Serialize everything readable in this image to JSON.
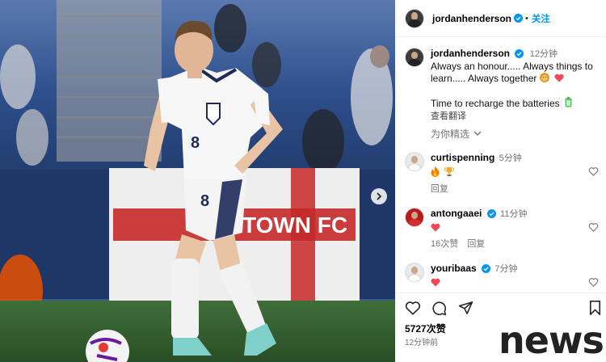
{
  "post": {
    "author": "jordanhenderson",
    "follow_label": "关注",
    "caption_time": "12分钟",
    "caption_line1": "Always an honour..... Always things to",
    "caption_line2": "learn..... Always together",
    "caption_line3": "Time to recharge the batteries",
    "translate_label": "查看翻译",
    "featured_label": "为你精选",
    "likes": "5727次赞",
    "time_ago": "12分钟前"
  },
  "photo": {
    "shirt_number": "8",
    "banner_text": "TOWN FC"
  },
  "comments": [
    {
      "user": "curtispenning",
      "time": "5分钟",
      "reply_label": "回复"
    },
    {
      "user": "antongaaei",
      "time": "11分钟",
      "likes": "16次赞",
      "reply_label": "回复"
    },
    {
      "user": "youribaas",
      "time": "7分钟"
    }
  ],
  "watermark": "news",
  "colors": {
    "link": "#0095f6",
    "verified": "#0095f6",
    "heart": "#ed4956",
    "muted": "#737373"
  },
  "icons": [
    "heart-icon",
    "comment-icon",
    "share-icon",
    "bookmark-icon",
    "verified-icon",
    "chevron-down-icon",
    "chevron-right-icon",
    "lion-emoji-icon",
    "battery-emoji-icon",
    "fire-emoji-icon",
    "trophy-emoji-icon"
  ]
}
